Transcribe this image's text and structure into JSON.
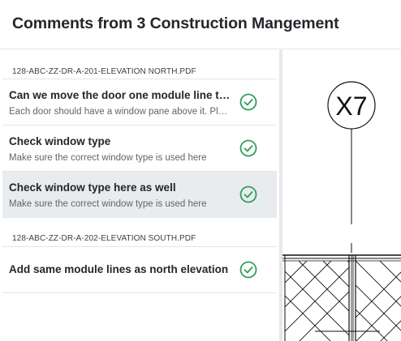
{
  "header": {
    "title": "Comments from 3 Construction Mangement"
  },
  "groups": [
    {
      "file": "128-ABC-ZZ-DR-A-201-ELEVATION NORTH.PDF",
      "items": [
        {
          "title": "Can we move the door one module line to the left?",
          "description": "Each door should have a window pane above it. Please check.",
          "resolved": true
        },
        {
          "title": "Check window type",
          "description": "Make sure the correct window type is used here",
          "resolved": true
        },
        {
          "title": "Check window type here as well",
          "description": "Make sure the correct window type is used here",
          "resolved": true,
          "selected": true
        }
      ]
    },
    {
      "file": "128-ABC-ZZ-DR-A-202-ELEVATION SOUTH.PDF",
      "items": [
        {
          "title": "Add same module lines as north elevation",
          "resolved": true
        }
      ]
    }
  ],
  "drawing": {
    "grid_label": "X7"
  },
  "colors": {
    "resolved_green": "#2e9e5b",
    "selected_bg": "#e9ecee"
  },
  "icons": {
    "resolved": "check-circle-icon"
  }
}
